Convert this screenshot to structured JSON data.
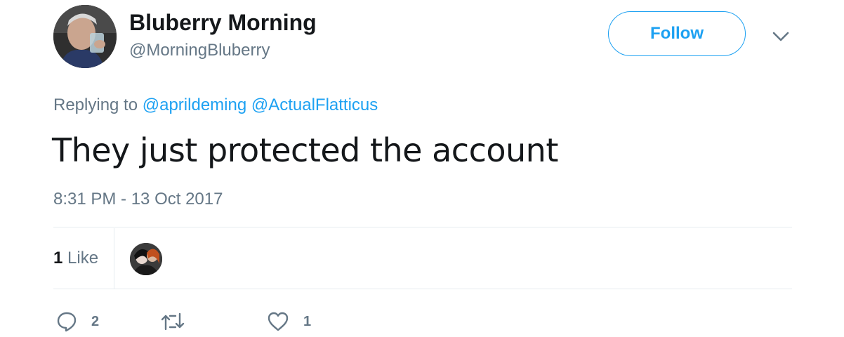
{
  "author": {
    "display_name": "Bluberry Morning",
    "screen_name": "@MorningBluberry",
    "avatar_icon": "profile-photo"
  },
  "follow_button": {
    "label": "Follow",
    "accent_color": "#1da1f2"
  },
  "more_menu": {
    "icon": "chevron-down-icon"
  },
  "reply_context": {
    "prefix": "Replying to",
    "mentions": [
      "@aprildeming",
      "@ActualFlatticus"
    ]
  },
  "tweet": {
    "text": "They just protected the account",
    "timestamp": "8:31 PM - 13 Oct 2017"
  },
  "stats": {
    "likes_count": "1",
    "likes_label": "Like"
  },
  "actions": {
    "reply": {
      "icon": "reply-icon",
      "count": "2"
    },
    "retweet": {
      "icon": "retweet-icon",
      "count": ""
    },
    "like": {
      "icon": "heart-icon",
      "count": "1"
    }
  },
  "colors": {
    "text_primary": "#14171a",
    "text_secondary": "#657786",
    "link": "#1da1f2",
    "divider": "#e6ecf0"
  }
}
